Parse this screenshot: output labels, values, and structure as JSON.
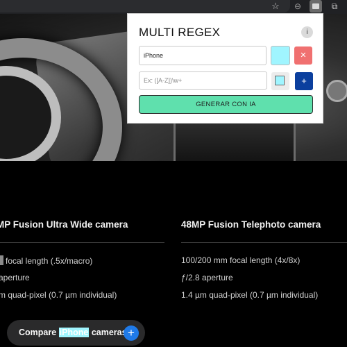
{
  "browser": {
    "star_icon": "star-icon",
    "extension_icons": [
      "circle-extension-icon",
      "regex-extension-icon",
      "puzzle-extension-icon"
    ]
  },
  "popup": {
    "title": "MULTI REGEX",
    "info_label": "i",
    "rules": [
      {
        "value": "iPhone",
        "color": "#a0f5ff"
      }
    ],
    "new_rule": {
      "placeholder": "Ex: ([A-Z])\\w+",
      "color": "#a0f5ff"
    },
    "delete_label": "✕",
    "add_label": "+",
    "generate_label": "GENERAR CON IA"
  },
  "colors": {
    "delete": "#f07070",
    "add": "#0b3f9e",
    "generate": "#5fe0ad",
    "compare_plus": "#1f7ae8",
    "highlight": "#a0f5ff"
  },
  "specs": {
    "left": {
      "title": "MP Fusion Ultra Wide camera",
      "lines": [
        "focal length (.5x/macro)",
        "aperture",
        "m quad-pixel (0.7 µm individual)"
      ]
    },
    "right": {
      "title": "48MP Fusion Telephoto camera",
      "lines": [
        "100/200 mm focal length (4x/8x)",
        "ƒ/2.8 aperture",
        "1.4 µm quad-pixel (0.7 µm individual)"
      ]
    }
  },
  "compare": {
    "prefix": "Compare",
    "highlight": "iPhone",
    "suffix": "cameras",
    "plus_label": "+"
  }
}
